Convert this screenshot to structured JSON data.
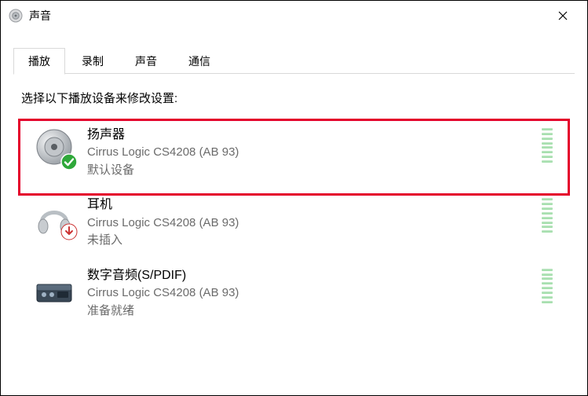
{
  "window": {
    "title": "声音"
  },
  "tabs": {
    "items": [
      {
        "label": "播放",
        "active": true
      },
      {
        "label": "录制",
        "active": false
      },
      {
        "label": "声音",
        "active": false
      },
      {
        "label": "通信",
        "active": false
      }
    ]
  },
  "content": {
    "prompt": "选择以下播放设备来修改设置:"
  },
  "devices": [
    {
      "icon": "speaker-icon",
      "name": "扬声器",
      "description": "Cirrus Logic CS4208 (AB 93)",
      "status": "默认设备",
      "overlay": "check",
      "highlighted": true
    },
    {
      "icon": "headphones-icon",
      "name": "耳机",
      "description": "Cirrus Logic CS4208 (AB 93)",
      "status": "未插入",
      "overlay": "down-arrow",
      "highlighted": false
    },
    {
      "icon": "spdif-icon",
      "name": "数字音频(S/PDIF)",
      "description": "Cirrus Logic CS4208 (AB 93)",
      "status": "准备就绪",
      "overlay": null,
      "highlighted": false
    }
  ]
}
